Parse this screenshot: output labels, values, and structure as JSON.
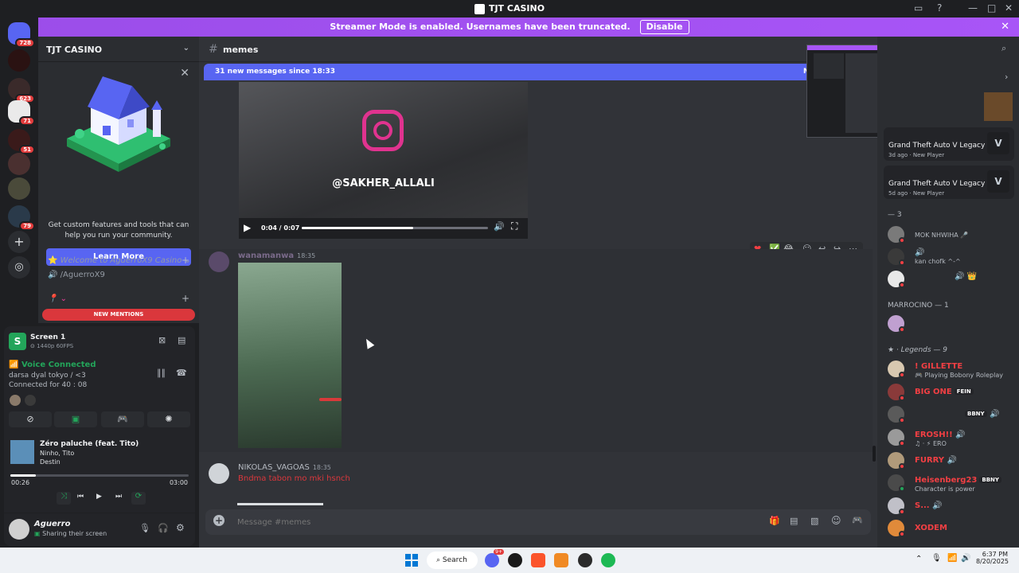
{
  "window": {
    "title": "TJT CASINO"
  },
  "banner": {
    "text": "Streamer Mode is enabled. Usernames have been truncated.",
    "disable_label": "Disable"
  },
  "guilds": {
    "badges": [
      "728",
      "623",
      "71",
      "51",
      "79"
    ]
  },
  "sidebar": {
    "server_name": "TJT CASINO",
    "promo_text": "Get custom features and tools that can help you run your community.",
    "promo_button": "Learn More",
    "category1": "Welcome to AguerroX9 Casino",
    "channel1": "/AguerroX9",
    "new_mentions": "NEW MENTIONS"
  },
  "voice": {
    "screen_title": "Screen 1",
    "screen_quality": "1440p 60FPS",
    "status": "Voice Connected",
    "channel": "darsa dyal tokyo / <3",
    "connected_time": "Connected for 40 : 08"
  },
  "music": {
    "title": "Zéro paluche (feat. Tito)",
    "artist": "Ninho, Tito",
    "album": "Destin",
    "elapsed": "00:26",
    "total": "03:00",
    "progress": 0.144
  },
  "user": {
    "name": "Aguerro",
    "status": "Sharing their screen"
  },
  "chat": {
    "channel": "memes",
    "new_messages": "31 new messages since 18:33",
    "new_messages_right": "M",
    "video_overlay_text": "@SAKHER_ALLALI",
    "video_time": "0:04 / 0:07",
    "video_progress": 0.6,
    "messages": [
      {
        "author": "wanamanwa",
        "time": "18:35",
        "text": ""
      },
      {
        "author": "NIKOLAS_VAGOAS",
        "time": "18:35",
        "text": "Bndma tabon mo mki hsnch"
      }
    ],
    "composer_placeholder": "Message #memes"
  },
  "members": {
    "activity_cards": [
      {
        "game": "Grand Theft Auto V Legacy",
        "meta": "3d ago",
        "tag": "New Player"
      },
      {
        "game": "Grand Theft Auto V Legacy",
        "meta": "5d ago",
        "tag": "New Player"
      }
    ],
    "group1": "— 3",
    "group1_members": [
      {
        "name": "",
        "status": "MOK NHWIHA 🎤"
      },
      {
        "name": "",
        "status": "kan chofk ^-^"
      },
      {
        "name": "",
        "status": ""
      }
    ],
    "group2": "MARROCINO — 1",
    "group3": "Legends — 9",
    "legends": [
      {
        "name": "! GILLETTE",
        "status": "Playing Bobony Roleplay",
        "tag": ""
      },
      {
        "name": "BIG ONE",
        "status": "",
        "tag": "FEIN"
      },
      {
        "name": "",
        "status": "",
        "tag": "BBNY"
      },
      {
        "name": "EROSH!!",
        "status": "ERO",
        "tag": ""
      },
      {
        "name": "FURRY",
        "status": "",
        "tag": ""
      },
      {
        "name": "Heisenberg23",
        "status": "Character is power",
        "tag": "BBNY"
      },
      {
        "name": "S...",
        "status": "",
        "tag": ""
      },
      {
        "name": "XODEM",
        "status": "",
        "tag": ""
      }
    ]
  },
  "taskbar": {
    "search": "Search",
    "time": "6:37 PM",
    "date": "8/20/2025",
    "discord_badge": "9+"
  },
  "colors": {
    "accent": "#5865f2",
    "banner": "#a855f7",
    "red": "#da373c",
    "green": "#23a55a"
  }
}
